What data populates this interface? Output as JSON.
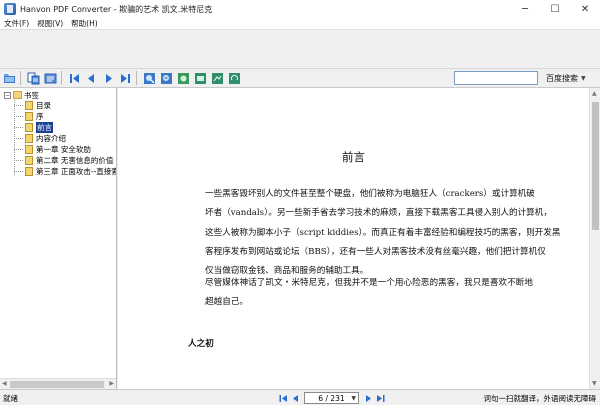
{
  "window": {
    "title": "Hanvon PDF Converter - 欺骗的艺术 凯文.米特尼克",
    "minimize": "─",
    "maximize": "☐",
    "close": "✕"
  },
  "menu": [
    "文件(F)",
    "视图(V)",
    "帮助(H)"
  ],
  "toolbar": {
    "search_value": "",
    "search_button": "百度搜索",
    "search_caret": "▼"
  },
  "sidebar": {
    "expander": "−",
    "root_label": "书签",
    "items": [
      {
        "label": "目录",
        "selected": false
      },
      {
        "label": "序",
        "selected": false
      },
      {
        "label": "前言",
        "selected": true
      },
      {
        "label": "内容介绍",
        "selected": false
      },
      {
        "label": "第一章 安全软肋",
        "selected": false
      },
      {
        "label": "第二章 无害信息的价值",
        "selected": false
      },
      {
        "label": "第三章 正面攻击--直接索取",
        "selected": false
      }
    ]
  },
  "document": {
    "title": "前言",
    "p1_lines": [
      "一些黑客毁坏别人的文件甚至整个硬盘，他们被称为电脑狂人（crackers）或计算机破",
      "坏者（vandals）。另一些新手省去学习技术的麻烦，直接下载黑客工具侵入别人的计算机，",
      "这些人被称为脚本小子（script kiddies）。而真正有着丰富经验和编程技巧的黑客，则开发黑",
      "客程序发布到网站或论坛（BBS），还有一些人对黑客技术没有丝毫兴趣，他们把计算机仅",
      "仅当做窃取金钱、商品和服务的辅助工具。"
    ],
    "p2_lines": [
      "尽管媒体神话了凯文・米特尼克，但我并不是一个用心险恶的黑客，我只是喜欢不断地",
      "超越自己。"
    ],
    "subhead": "人之初"
  },
  "status": {
    "left": "就绪",
    "page": "6 / 231",
    "page_caret": "▼",
    "right": "词句一扫就翻译，外语阅读无障碍"
  }
}
